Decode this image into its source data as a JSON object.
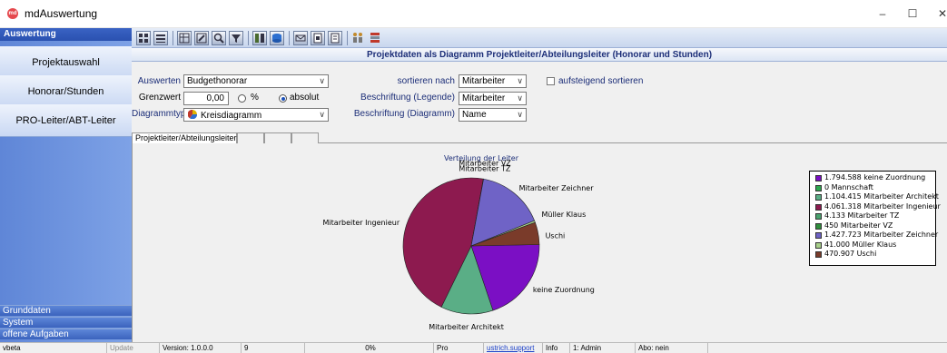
{
  "window": {
    "title": "mdAuswertung",
    "app_badge": "md",
    "minimize_glyph": "–",
    "maximize_glyph": "☐",
    "close_glyph": "✕"
  },
  "sidebar": {
    "header": "Auswertung",
    "items": [
      {
        "label": "Projektauswahl"
      },
      {
        "label": "Honorar/Stunden"
      },
      {
        "label": "PRO-Leiter/ABT-Leiter"
      }
    ],
    "bottom_items": [
      {
        "label": "Grunddaten"
      },
      {
        "label": "System"
      },
      {
        "label": "offene Aufgaben"
      }
    ]
  },
  "toolbar": {
    "buttons": [
      "grid-view-icon",
      "list-view-icon",
      "table-icon",
      "edit-table-icon",
      "search-icon",
      "filter-icon",
      "columns-icon",
      "database-icon",
      "mail-icon",
      "print-preview-icon",
      "print-icon",
      "users-icon",
      "settings-icon"
    ]
  },
  "main": {
    "title": "Projektdaten als Diagramm Projektleiter/Abteilungsleiter (Honorar und Stunden)"
  },
  "form": {
    "auswerten_label": "Auswerten",
    "auswerten_value": "Budgethonorar",
    "grenzwert_label": "Grenzwert",
    "grenzwert_value": "0,00",
    "percent_label": "%",
    "absolut_label": "absolut",
    "diagrammtyp_label": "Diagrammtyp",
    "diagrammtyp_value": "Kreisdiagramm",
    "sortieren_label": "sortieren nach",
    "sortieren_value": "Mitarbeiter",
    "legende_label": "Beschriftung (Legende)",
    "legende_value": "Mitarbeiter",
    "diagramm_label": "Beschriftung (Diagramm)",
    "diagramm_value": "Name",
    "aufsteigend_label": "aufsteigend sortieren",
    "combo_arrow": "∨"
  },
  "tabs": {
    "active": "Projektleiter/Abteilungsleiter"
  },
  "chart_data": {
    "type": "pie",
    "title": "Verteilung der Leiter",
    "legend_position": "right",
    "slices": [
      {
        "legend": "1.794.588 keine Zuordnung",
        "label": "keine Zuordnung",
        "value": 1794588,
        "color": "#7b0fc4"
      },
      {
        "legend": "0 Mannschaft",
        "label": "",
        "value": 0,
        "color": "#2ea84f"
      },
      {
        "legend": "1.104.415 Mitarbeiter Architekt",
        "label": "Mitarbeiter Architekt",
        "value": 1104415,
        "color": "#5aae86"
      },
      {
        "legend": "4.061.318 Mitarbeiter Ingenieur",
        "label": "Mitarbeiter Ingenieur",
        "value": 4061318,
        "color": "#8d1a4f"
      },
      {
        "legend": "4.133 Mitarbeiter TZ",
        "label": "Mitarbeiter TZ",
        "value": 4133,
        "color": "#49a36e"
      },
      {
        "legend": "450 Mitarbeiter VZ",
        "label": "Mitarbeiter VZ",
        "value": 450,
        "color": "#2f8f3c"
      },
      {
        "legend": "1.427.723 Mitarbeiter Zeichner",
        "label": "Mitarbeiter Zeichner",
        "value": 1427723,
        "color": "#6f63c6"
      },
      {
        "legend": "41.000 Müller Klaus",
        "label": "Müller Klaus",
        "value": 41000,
        "color": "#a8d08a"
      },
      {
        "legend": "470.907 Uschi",
        "label": "Uschi",
        "value": 470907,
        "color": "#7a3b2a"
      }
    ]
  },
  "statusbar": {
    "fields": [
      "vbeta",
      "Update",
      "Version: 1.0.0.0",
      "9",
      "0%",
      "Pro",
      "ustrich.support",
      "Info",
      "1: Admin",
      "Abo: nein"
    ]
  }
}
